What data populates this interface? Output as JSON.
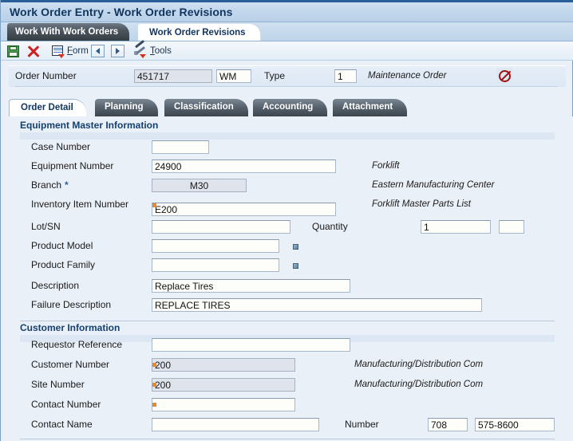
{
  "window": {
    "title": "Work Order Entry - Work Order Revisions"
  },
  "form_tabs": [
    {
      "label": "Work With Work Orders",
      "active": false
    },
    {
      "label": "Work Order Revisions",
      "active": true
    }
  ],
  "toolbar": {
    "save_icon": "save-disk-icon",
    "delete_icon": "delete-x-icon",
    "form_icon": "form-menu-icon",
    "form_label": "Form",
    "prev_icon": "chevron-left-icon",
    "next_icon": "chevron-right-icon",
    "tools_icon": "tools-hammer-wrench-icon",
    "tools_label": "Tools"
  },
  "header": {
    "order_number_label": "Order Number",
    "order_number_value": "451717",
    "order_type_code_value": "WM",
    "type_label": "Type",
    "type_value": "1",
    "type_description": "Maintenance Order",
    "status_icon": "prohibited-icon"
  },
  "section_tabs": [
    {
      "label": "Order Detail",
      "active": true
    },
    {
      "label": "Planning",
      "active": false
    },
    {
      "label": "Classification",
      "active": false
    },
    {
      "label": "Accounting",
      "active": false
    },
    {
      "label": "Attachment",
      "active": false
    }
  ],
  "equipment_section": {
    "title": "Equipment Master Information",
    "fields": [
      {
        "label": "Case Number",
        "value": "",
        "description": "",
        "required": false,
        "disabled": false,
        "marker": false
      },
      {
        "label": "Equipment Number",
        "value": "24900",
        "description": "Forklift",
        "required": false,
        "disabled": false,
        "marker": false
      },
      {
        "label": "Branch",
        "value": "M30",
        "description": "Eastern Manufacturing Center",
        "required": true,
        "disabled": true,
        "marker": false
      },
      {
        "label": "Inventory Item Number",
        "value": "E200",
        "description": "Forklift Master Parts List",
        "required": false,
        "disabled": false,
        "marker": true
      },
      {
        "label": "Lot/SN",
        "value": "",
        "description": "",
        "required": false,
        "disabled": false,
        "marker": false
      },
      {
        "label": "Product Model",
        "value": "",
        "description": "",
        "required": false,
        "disabled": false,
        "marker": false
      },
      {
        "label": "Product Family",
        "value": "",
        "description": "",
        "required": false,
        "disabled": false,
        "marker": false
      },
      {
        "label": "Description",
        "value": "Replace Tires",
        "description": "",
        "required": false,
        "disabled": false,
        "marker": false
      },
      {
        "label": "Failure Description",
        "value": "REPLACE TIRES",
        "description": "",
        "required": false,
        "disabled": false,
        "marker": false
      }
    ],
    "quantity_label": "Quantity",
    "quantity_value": "1",
    "quantity_uom_value": ""
  },
  "customer_section": {
    "title": "Customer Information",
    "fields": [
      {
        "label": "Requestor Reference",
        "value": "",
        "description": "",
        "disabled": false,
        "marker": false
      },
      {
        "label": "Customer Number",
        "value": "200",
        "description": "Manufacturing/Distribution Com",
        "disabled": true,
        "marker": true
      },
      {
        "label": "Site Number",
        "value": "200",
        "description": "Manufacturing/Distribution Com",
        "disabled": true,
        "marker": true
      },
      {
        "label": "Contact Number",
        "value": "",
        "description": "",
        "disabled": false,
        "marker": true
      },
      {
        "label": "Contact Name",
        "value": "",
        "description": "",
        "disabled": false,
        "marker": false
      }
    ],
    "number_label": "Number",
    "number_area_value": "708",
    "number_value": "575-8600"
  },
  "colors": {
    "titlebar_text": "#10355e",
    "background": "#eaf0f8",
    "accent_blue": "#2a5d8f",
    "marker_orange": "#e8892a",
    "prohibit_red": "#9c1414",
    "section_heading": "#15406e"
  }
}
